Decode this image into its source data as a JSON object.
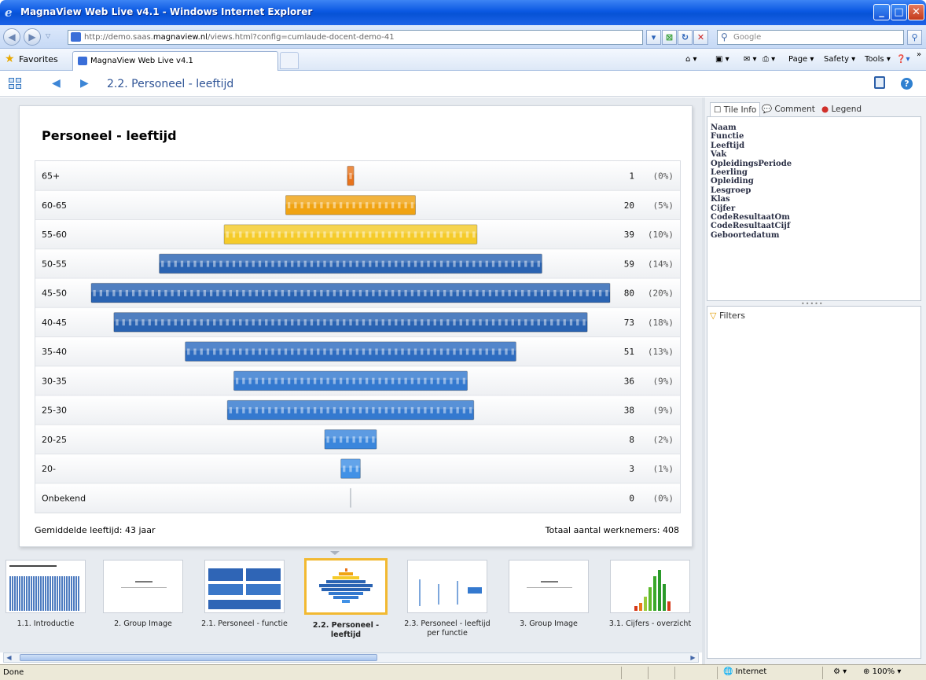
{
  "window": {
    "title": "MagnaView Web Live v4.1 - Windows Internet Explorer",
    "buttons": {
      "minimize": "_",
      "maximize": "□",
      "close": "✕"
    }
  },
  "browser": {
    "url_prefix": "http://demo.saas.",
    "url_host": "magnaview.nl",
    "url_rest": "/views.html?config=cumlaude-docent-demo-41",
    "search_placeholder": "Google",
    "favorites_label": "Favorites",
    "tab_title": "MagnaView Web Live v4.1",
    "commands": {
      "page": "Page",
      "safety": "Safety",
      "tools": "Tools"
    }
  },
  "header": {
    "breadcrumb": "2.2. Personeel - leeftijd"
  },
  "tile": {
    "title": "Personeel - leeftijd",
    "footer_left": "Gemiddelde leeftijd: 43 jaar",
    "footer_right": "Totaal aantal werknemers: 408"
  },
  "chart_data": {
    "type": "bar",
    "orientation": "horizontal-centered",
    "categories": [
      "65+",
      "60-65",
      "55-60",
      "50-55",
      "45-50",
      "40-45",
      "35-40",
      "30-35",
      "25-30",
      "20-25",
      "20-",
      "Onbekend"
    ],
    "values": [
      1,
      20,
      39,
      59,
      80,
      73,
      51,
      36,
      38,
      8,
      3,
      0
    ],
    "percent_labels": [
      "(0%)",
      "(5%)",
      "(10%)",
      "(14%)",
      "(20%)",
      "(18%)",
      "(13%)",
      "(9%)",
      "(9%)",
      "(2%)",
      "(1%)",
      "(0%)"
    ],
    "bar_colors": [
      "#e8731c",
      "#f0a312",
      "#f5cb2a",
      "#2a63b2",
      "#2a63b2",
      "#2a63b2",
      "#2e6cc0",
      "#3479cf",
      "#3479cf",
      "#3a86dc",
      "#4191e6",
      "#9aa3ad"
    ],
    "xlim": [
      0,
      80
    ]
  },
  "thumbnails": [
    {
      "label": "1.1. Introductie",
      "selected": false
    },
    {
      "label": "2. Group Image",
      "selected": false
    },
    {
      "label": "2.1. Personeel - functie",
      "selected": false
    },
    {
      "label": "2.2. Personeel - leeftijd",
      "selected": true
    },
    {
      "label": "2.3. Personeel - leeftijd per functie",
      "selected": false
    },
    {
      "label": "3. Group Image",
      "selected": false
    },
    {
      "label": "3.1. Cijfers - overzicht",
      "selected": false
    }
  ],
  "right_panel": {
    "tabs": {
      "tile_info": "Tile Info",
      "comment": "Comment",
      "legend": "Legend"
    },
    "fields": [
      "Naam",
      "Functie",
      "Leeftijd",
      "Vak",
      "OpleidingsPeriode",
      "Leerling",
      "Opleiding",
      "Lesgroep",
      "Klas",
      "Cijfer",
      "CodeResultaatOm",
      "CodeResultaatCijf",
      "Geboortedatum"
    ],
    "filters_label": "Filters"
  },
  "status": {
    "left": "Done",
    "zone": "Internet",
    "zoom": "100%"
  }
}
